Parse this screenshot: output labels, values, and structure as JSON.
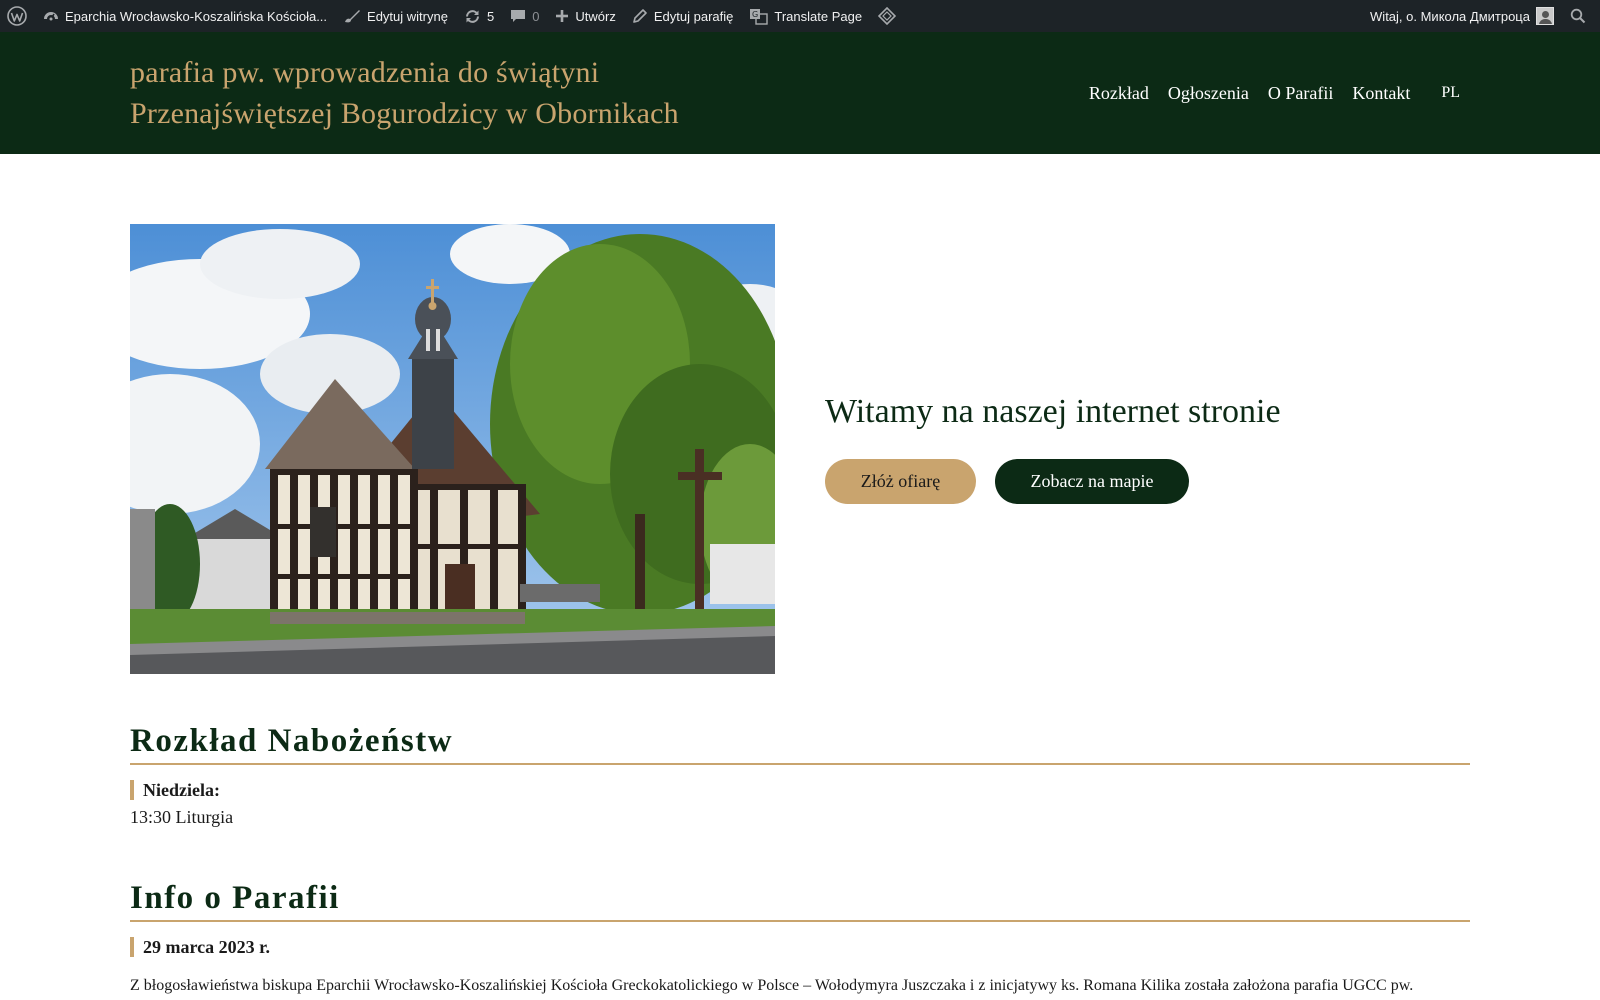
{
  "admin_bar": {
    "site_name": "Eparchia Wrocławsko-Koszalińska Kościoła...",
    "edit_site": "Edytuj witrynę",
    "updates_count": "5",
    "comments_count": "0",
    "new": "Utwórz",
    "edit_parish": "Edytuj parafię",
    "translate": "Translate Page",
    "greeting": "Witaj, o. Микола Дмитроца",
    "icons": [
      "wordpress-icon",
      "dashboard-icon",
      "brush-icon",
      "updates-icon",
      "comment-icon",
      "plus-icon",
      "pencil-icon",
      "translate-icon",
      "diamond-icon",
      "search-icon"
    ]
  },
  "header": {
    "title_line1": "parafia pw. wprowadzenia do świątyni",
    "title_line2": "Przenajświętszej Bogurodzicy w Obornikach",
    "nav": [
      "Rozkład",
      "Ogłoszenia",
      "O Parafii",
      "Kontakt"
    ],
    "language": "PL"
  },
  "hero": {
    "welcome": "Witamy na naszej internet stronie",
    "donate_button": "Złóż ofiarę",
    "map_button": "Zobacz na mapie"
  },
  "schedule": {
    "title": "Rozkład Nabożeństw",
    "day": "Niedziela:",
    "entry": "13:30 Liturgia"
  },
  "info": {
    "title": "Info o Parafii",
    "date": "29 marca 2023 r.",
    "text": "Z błogosławieństwa biskupa Eparchii Wrocławsko-Koszalińskiej Kościoła Greckokatolickiego w Polsce – Wołodymyra Juszczaka i z inicjatywy ks. Romana Kilika została założona parafia UGCC pw."
  },
  "colors": {
    "admin_bar": "#1d2327",
    "header_bg": "#0c2a15",
    "accent_gold": "#c9a46e",
    "white": "#ffffff"
  }
}
